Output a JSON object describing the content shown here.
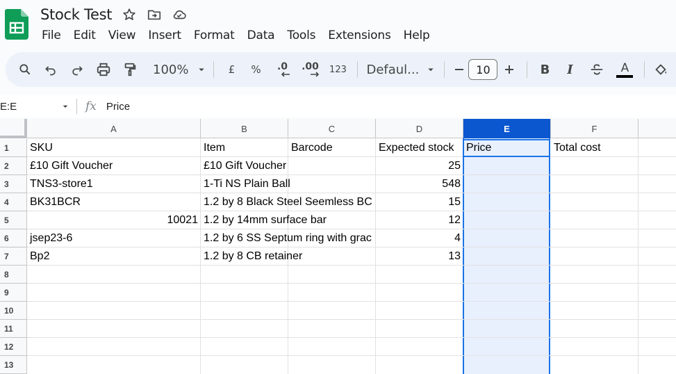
{
  "app": {
    "title": "Stock Test",
    "brand_color": "#0f9d58"
  },
  "menu": [
    "File",
    "Edit",
    "View",
    "Insert",
    "Format",
    "Data",
    "Tools",
    "Extensions",
    "Help"
  ],
  "toolbar": {
    "zoom": "100%",
    "currency": "£",
    "percent": "%",
    "decrease_decimal": ".0",
    "increase_decimal": ".00",
    "number_format": "123",
    "font": "Defaul...",
    "font_size": "10",
    "bold": "B",
    "italic": "I",
    "text_color": "A"
  },
  "formula_bar": {
    "name_box": "E:E",
    "fx": "fx",
    "value": "Price"
  },
  "columns": [
    "A",
    "B",
    "C",
    "D",
    "E",
    "F"
  ],
  "rows": [
    "1",
    "2",
    "3",
    "4",
    "5",
    "6",
    "7",
    "8",
    "9",
    "10",
    "11",
    "12",
    "13"
  ],
  "cells": {
    "r1": {
      "a": "SKU",
      "b": "Item",
      "c": "Barcode",
      "d": "Expected stock",
      "e": "Price",
      "f": "Total cost"
    },
    "r2": {
      "a": "£10 Gift Voucher",
      "b": "£10 Gift Voucher",
      "d": "25"
    },
    "r3": {
      "a": "TNS3-store1",
      "b": "1-Ti NS Plain Ball",
      "d": "548"
    },
    "r4": {
      "a": "BK31BCR",
      "b": "1.2 by  8 Black Steel Seemless BС",
      "d": "15"
    },
    "r5": {
      "a": "10021",
      "b": "1.2 by 14mm surface bar",
      "d": "12"
    },
    "r6": {
      "a": "jsep23-6",
      "b": "1.2 by 6 SS Septum ring with grac",
      "d": "4"
    },
    "r7": {
      "a": "Bp2",
      "b": "1.2 by 8 CB retainer",
      "d": "13"
    }
  }
}
